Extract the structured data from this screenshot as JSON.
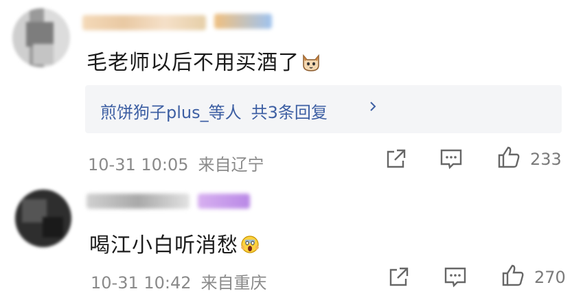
{
  "comments": [
    {
      "text": "毛老师以后不用买酒了",
      "emoji": "cat-face-icon",
      "replies_names": "煎饼狗子plus_等人",
      "replies_count": "共3条回复",
      "time": "10-31 10:05",
      "location": "来自辽宁",
      "likes": "233"
    },
    {
      "text": "喝江小白听消愁",
      "emoji": "screaming-face-icon",
      "time": "10-31 10:42",
      "location": "来自重庆",
      "likes": "270"
    }
  ],
  "colors": {
    "link": "#3d5fa3",
    "meta": "#8a8a8a",
    "reply_bg": "#f4f5f7"
  }
}
